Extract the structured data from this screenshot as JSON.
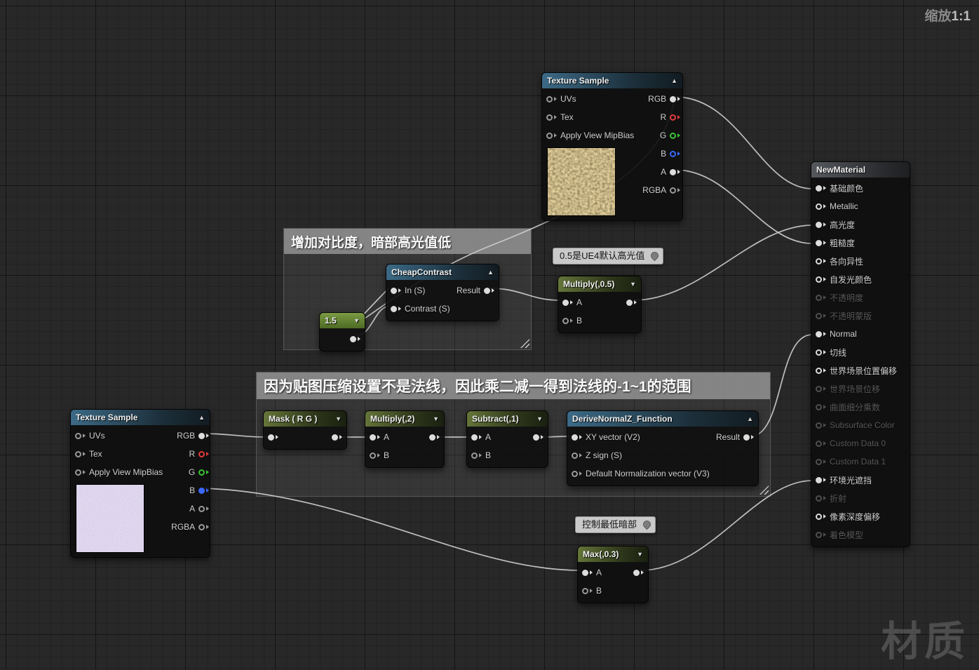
{
  "viewport": {
    "zoom_label": "缩放",
    "zoom_value": "1:1",
    "watermark": "材质"
  },
  "icons": {
    "collapse": "▲",
    "expand": "▼",
    "pushpin": "pushpin-icon"
  },
  "colors": {
    "wire": "#cccccc",
    "pin_white": "#dcdcdc",
    "pin_red": "#e33b3b",
    "pin_green": "#37c431",
    "pin_blue": "#3a68ff",
    "pin_disabled": "#4f4f4f",
    "header_texture_blue": "#3c6a86",
    "header_math_green": "#647539",
    "header_constant_green": "#7a9a43",
    "header_material_gray": "#55595e",
    "comment_gray": "#8b8b8b"
  },
  "comments": {
    "contrast": {
      "title": "增加对比度，暗部高光值低"
    },
    "normal_range": {
      "title": "因为贴图压缩设置不是法线，因此乘二减一得到法线的-1~1的范围"
    },
    "bubble_specular": {
      "text": "0.5是UE4默认高光值"
    },
    "bubble_ao": {
      "text": "控制最低暗部"
    }
  },
  "nodes": {
    "texture_sample_top": {
      "title": "Texture Sample",
      "inputs": [
        "UVs",
        "Tex",
        "Apply View MipBias"
      ],
      "outputs": [
        {
          "label": "RGB"
        },
        {
          "label": "R"
        },
        {
          "label": "G"
        },
        {
          "label": "B"
        },
        {
          "label": "A"
        },
        {
          "label": "RGBA"
        }
      ]
    },
    "texture_sample_bottom": {
      "title": "Texture Sample",
      "inputs": [
        "UVs",
        "Tex",
        "Apply View MipBias"
      ],
      "outputs": [
        {
          "label": "RGB"
        },
        {
          "label": "R"
        },
        {
          "label": "G"
        },
        {
          "label": "B"
        },
        {
          "label": "A"
        },
        {
          "label": "RGBA"
        }
      ]
    },
    "cheap_contrast": {
      "title": "CheapContrast",
      "in_signal": "In (S)",
      "in_contrast": "Contrast (S)",
      "out_result": "Result"
    },
    "constant_15": {
      "value": "1.5"
    },
    "multiply_half": {
      "title": "Multiply(,0.5)",
      "in_a": "A",
      "in_b": "B"
    },
    "mask_rg": {
      "title": "Mask ( R G )"
    },
    "multiply_two": {
      "title": "Multiply(,2)",
      "in_a": "A",
      "in_b": "B"
    },
    "subtract_one": {
      "title": "Subtract(,1)",
      "in_a": "A",
      "in_b": "B"
    },
    "derive_normal_z": {
      "title": "DeriveNormalZ_Function",
      "in_xy": "XY vector (V2)",
      "in_zsign": "Z sign (S)",
      "in_default": "Default Normalization vector (V3)",
      "out_result": "Result"
    },
    "max_03": {
      "title": "Max(,0.3)",
      "in_a": "A",
      "in_b": "B"
    },
    "new_material": {
      "title": "NewMaterial",
      "pins": [
        {
          "label": "基础颜色",
          "state": "connected"
        },
        {
          "label": "Metallic",
          "state": "open"
        },
        {
          "label": "高光度",
          "state": "connected"
        },
        {
          "label": "粗糙度",
          "state": "connected"
        },
        {
          "label": "各向异性",
          "state": "open"
        },
        {
          "label": "自发光颜色",
          "state": "open"
        },
        {
          "label": "不透明度",
          "state": "disabled"
        },
        {
          "label": "不透明蒙版",
          "state": "disabled"
        },
        {
          "label": "Normal",
          "state": "connected"
        },
        {
          "label": "切线",
          "state": "open"
        },
        {
          "label": "世界场景位置偏移",
          "state": "open"
        },
        {
          "label": "世界场景位移",
          "state": "disabled"
        },
        {
          "label": "曲面细分乘数",
          "state": "disabled"
        },
        {
          "label": "Subsurface Color",
          "state": "disabled"
        },
        {
          "label": "Custom Data 0",
          "state": "disabled"
        },
        {
          "label": "Custom Data 1",
          "state": "disabled"
        },
        {
          "label": "环境光遮挡",
          "state": "connected"
        },
        {
          "label": "折射",
          "state": "disabled"
        },
        {
          "label": "像素深度偏移",
          "state": "open"
        },
        {
          "label": "着色模型",
          "state": "disabled"
        }
      ]
    }
  }
}
